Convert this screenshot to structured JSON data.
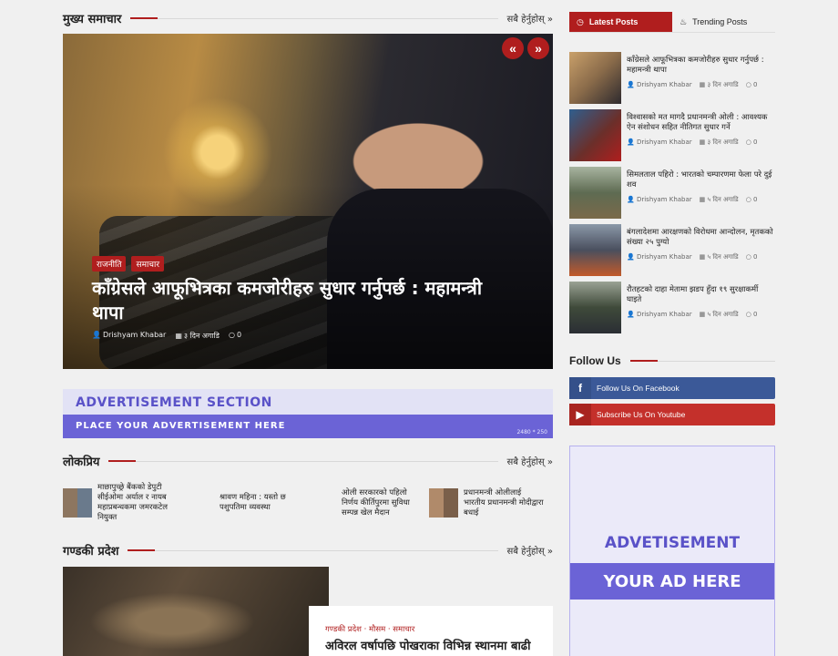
{
  "main_news": {
    "heading": "मुख्य समाचार",
    "more_label": "सबै हेर्नुहोस्",
    "more_arrow": "»",
    "hero": {
      "prev_arrow": "«",
      "next_arrow": "»",
      "categories": [
        "राजनीति",
        "समाचार"
      ],
      "title": "काँग्रेसले आफूभित्रका कमजोरीहरु सुधार गर्नुपर्छ : महामन्त्री थापा",
      "author": "Drishyam Khabar",
      "date": "३ दिन अगाडि",
      "comments": "0"
    }
  },
  "ad_banner": {
    "title": "ADVERTISEMENT SECTION",
    "subtitle": "PLACE YOUR ADVERTISEMENT HERE",
    "size": "2480 * 250"
  },
  "popular": {
    "heading": "लोकप्रिय",
    "more_label": "सबै हेर्नुहोस्",
    "more_arrow": "»",
    "items": [
      {
        "title": "माछापुच्छ्रे बैंकको डेपुटी सीईओमा अर्याल र नायब महाप्रबन्धकमा जमरकटेल नियुक्त",
        "has_thumb": true
      },
      {
        "title": "श्रावण महिना : यस्तो छ पशुपतिमा व्यवस्था",
        "has_thumb": false
      },
      {
        "title": "ओली सरकारको पहिलो निर्णय कीर्तिपुरमा सुविधा सम्पन्न खेल मैदान",
        "has_thumb": false
      },
      {
        "title": "प्रधानमन्त्री ओलीलाई भारतीय प्रधानमन्त्री मोदीद्वारा बधाई",
        "has_thumb": true
      }
    ]
  },
  "gandaki": {
    "heading": "गण्डकी प्रदेश",
    "more_label": "सबै हेर्नुहोस्",
    "more_arrow": "»",
    "categories": "गण्डकी प्रदेश · मौसम · समाचार",
    "title": "अविरल वर्षापछि पोखराका विभिन्न स्थानमा बाढी"
  },
  "sidebar": {
    "tabs": [
      {
        "label": "Latest Posts",
        "icon": "clock-icon",
        "active": true
      },
      {
        "label": "Trending Posts",
        "icon": "fire-icon",
        "active": false
      }
    ],
    "posts": [
      {
        "title": "काँग्रेसले आफूभित्रका कमजोरीहरु सुधार गर्नुपर्छ : महामन्त्री थापा",
        "author": "Drishyam Khabar",
        "date": "३ दिन अगाडि",
        "comments": "0",
        "thumb_color": "#8a6b4a"
      },
      {
        "title": "विश्वासको मत मागदै प्रधानमन्त्री ओली : आवश्यक ऐन संशोधन सहित नीतिगत सुधार गर्ने",
        "author": "Drishyam Khabar",
        "date": "३ दिन अगाडि",
        "comments": "0",
        "thumb_color": "#6b2f2a"
      },
      {
        "title": "सिमलताल पहिरो : भारतको चम्पारणमा फेला परे दुई शव",
        "author": "Drishyam Khabar",
        "date": "५ दिन अगाडि",
        "comments": "0",
        "thumb_color": "#5e6b52"
      },
      {
        "title": "बंगलादेशमा आरक्षणको विरोधमा आन्दोलन, मृतकको संख्या २५ पुग्यो",
        "author": "Drishyam Khabar",
        "date": "५ दिन अगाडि",
        "comments": "0",
        "thumb_color": "#4a4f5e"
      },
      {
        "title": "रौतहटको दाहा मेतामा झडप हुँदा १९ सुरक्षाकर्मी घाइते",
        "author": "Drishyam Khabar",
        "date": "५ दिन अगाडि",
        "comments": "0",
        "thumb_color": "#3f4a3a"
      }
    ],
    "follow": {
      "heading": "Follow Us",
      "facebook_label": "Follow Us On Facebook",
      "youtube_label": "Subscribe Us On Youtube"
    },
    "ad": {
      "line1": "ADVETISEMENT",
      "line2": "YOUR AD HERE"
    }
  },
  "colors": {
    "accent": "#b01e1e",
    "facebook": "#3b5998",
    "youtube": "#c4302b",
    "ad_purple": "#6b63d6"
  }
}
